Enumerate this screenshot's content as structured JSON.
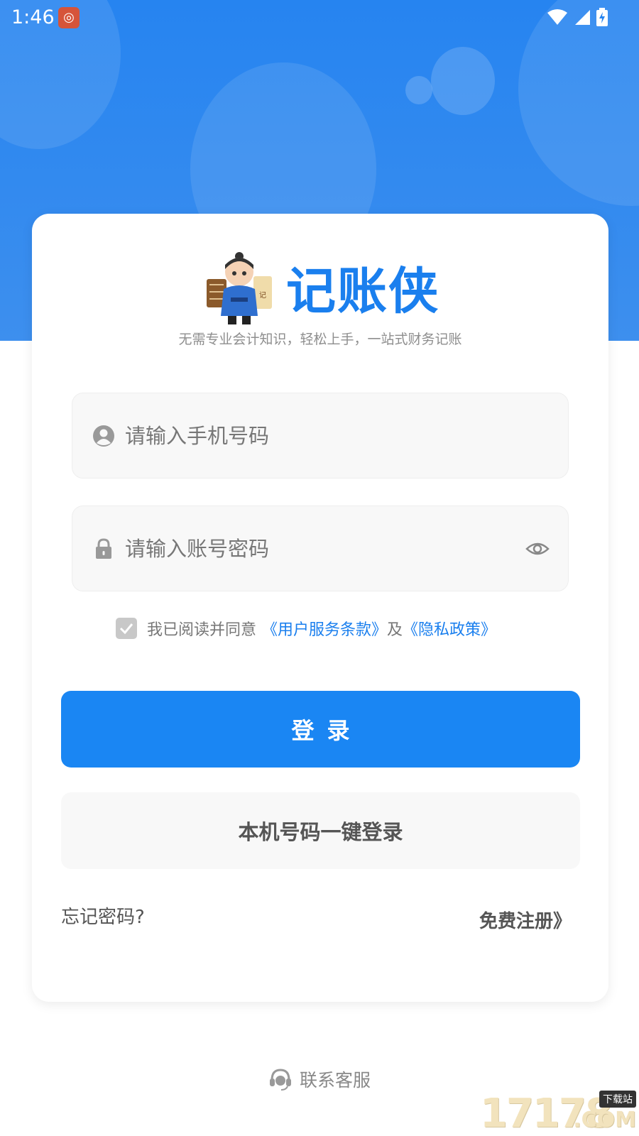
{
  "status_bar": {
    "time": "1:46",
    "app_icon": "weibo-icon",
    "icons": [
      "wifi-icon",
      "signal-icon",
      "battery-charging-icon"
    ]
  },
  "brand": {
    "name": "记账侠",
    "tagline": "无需专业会计知识，轻松上手，一站式财务记账",
    "accent_color": "#1a7fee"
  },
  "login_form": {
    "phone_placeholder": "请输入手机号码",
    "password_placeholder": "请输入账号密码",
    "agreement": {
      "prefix": "我已阅读并同意",
      "terms_link": "《用户服务条款》",
      "conjunction": "及",
      "privacy_link": "《隐私政策》",
      "checked": true
    },
    "login_button": "登录",
    "one_click_button": "本机号码一键登录",
    "forgot_password": "忘记密码?",
    "register_link": "免费注册》"
  },
  "support": {
    "label": "联系客服"
  },
  "watermark": {
    "number": "17178",
    "tag": "下载站",
    "suffix": ".COM"
  }
}
